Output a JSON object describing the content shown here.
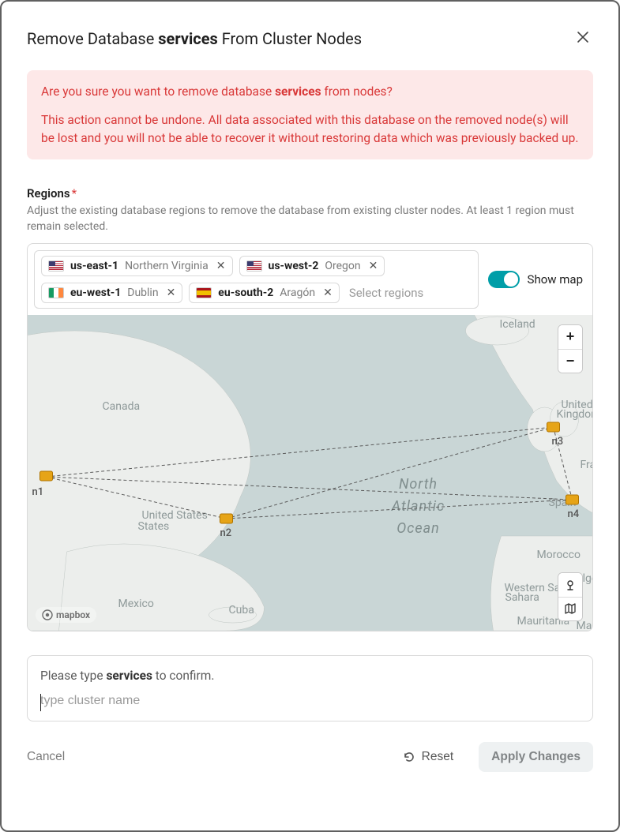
{
  "dialog": {
    "title_pre": "Remove Database ",
    "title_bold": "services",
    "title_post": " From Cluster Nodes"
  },
  "warning": {
    "line1_pre": "Are you sure you want to remove database ",
    "line1_bold": "services",
    "line1_post": " from nodes?",
    "line2": "This action cannot be undone. All data associated with this database on the removed node(s) will be lost and you will not be able to recover it without restoring data which was previously backed up."
  },
  "regions": {
    "label": "Regions",
    "required_mark": "*",
    "help": "Adjust the existing database regions to remove the database from existing cluster nodes. At least 1 region must remain selected.",
    "placeholder": "Select regions",
    "show_map_label": "Show map",
    "chips": [
      {
        "flag": "us",
        "code": "us-east-1",
        "loc": "Northern Virginia"
      },
      {
        "flag": "us",
        "code": "us-west-2",
        "loc": "Oregon"
      },
      {
        "flag": "ie",
        "code": "eu-west-1",
        "loc": "Dublin"
      },
      {
        "flag": "es",
        "code": "eu-south-2",
        "loc": "Aragón"
      }
    ]
  },
  "map": {
    "attribution": "mapbox",
    "zoom_in": "+",
    "zoom_out": "−",
    "labels": {
      "iceland": "Iceland",
      "canada": "Canada",
      "uk": "United Kingdom",
      "france": "Fra",
      "us": "United States",
      "spain": "Spain",
      "morocco": "Morocco",
      "algeria": "Alge",
      "wsahara": "Western Sahara",
      "mexico": "Mexico",
      "cuba": "Cuba",
      "mauritania": "Mauritania",
      "mali": "Mali",
      "ocean1": "North",
      "ocean2": "Atlantic",
      "ocean3": "Ocean"
    },
    "nodes": {
      "n1": "n1",
      "n2": "n2",
      "n3": "n3",
      "n4": "n4"
    }
  },
  "confirm": {
    "prompt_pre": "Please type ",
    "prompt_bold": "services",
    "prompt_post": " to confirm.",
    "placeholder": "type cluster name"
  },
  "footer": {
    "cancel": "Cancel",
    "reset": "Reset",
    "apply": "Apply Changes"
  }
}
